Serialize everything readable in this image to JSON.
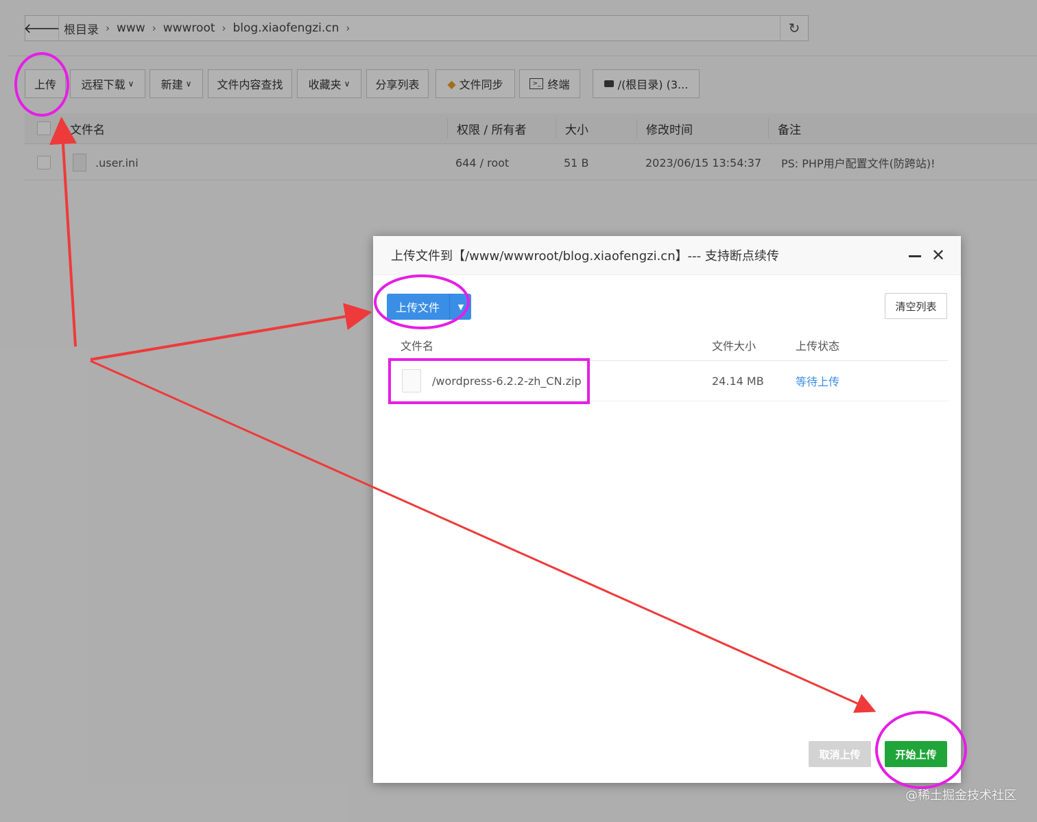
{
  "pathbar": {
    "crumbs": [
      "根目录",
      "www",
      "wwwroot",
      "blog.xiaofengzi.cn"
    ],
    "separator": "›",
    "back_icon": "arrow-left-icon",
    "refresh_icon": "refresh-icon"
  },
  "toolbar": {
    "upload": "上传",
    "remote_download": "远程下载",
    "new": "新建",
    "search_content": "文件内容查找",
    "favorites": "收藏夹",
    "share_list": "分享列表",
    "file_sync": "文件同步",
    "terminal": "终端",
    "disk": "/(根目录) (3..."
  },
  "table": {
    "headers": [
      "文件名",
      "权限 / 所有者",
      "大小",
      "修改时间",
      "备注"
    ],
    "rows": [
      {
        "name": ".user.ini",
        "perm": "644 / root",
        "size": "51 B",
        "mtime": "2023/06/15 13:54:37",
        "note": "PS: PHP用户配置文件(防跨站)!"
      }
    ]
  },
  "dialog": {
    "title": "上传文件到【/www/wwwroot/blog.xiaofengzi.cn】--- 支持断点续传",
    "upload_btn": "上传文件",
    "clear_btn": "清空列表",
    "headers": [
      "文件名",
      "文件大小",
      "上传状态"
    ],
    "files": [
      {
        "name": "/wordpress-6.2.2-zh_CN.zip",
        "size": "24.14 MB",
        "status": "等待上传"
      }
    ],
    "cancel_btn": "取消上传",
    "start_btn": "开始上传"
  },
  "colors": {
    "primary_blue": "#3a8ee6",
    "start_green": "#20a53a",
    "annotation_magenta": "#e61ee6",
    "annotation_red": "#ee3a3a"
  },
  "watermark": "@稀土掘金技术社区"
}
